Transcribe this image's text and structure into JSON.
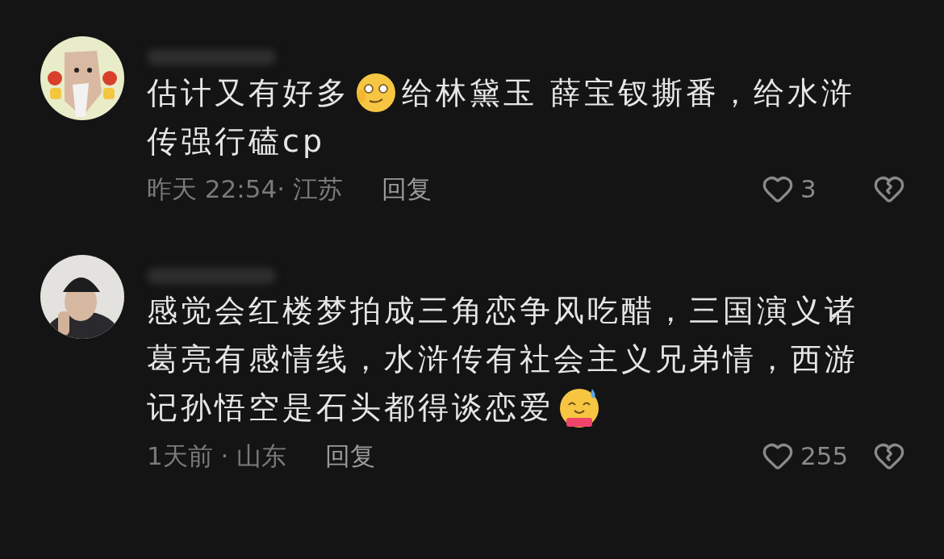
{
  "comments": [
    {
      "avatar": {
        "kind": "cartoon"
      },
      "lines": [
        [
          {
            "kind": "text",
            "text": "估计又有好多"
          },
          {
            "kind": "smirk_emoji"
          },
          {
            "kind": "text",
            "text": "给林黛玉 薛宝钗撕番，给水浒"
          }
        ],
        [
          {
            "kind": "text",
            "text": "传强行磕cp"
          }
        ]
      ],
      "time": "昨天 22:54· 江苏",
      "reply": "回复",
      "likes": "3"
    },
    {
      "avatar": {
        "kind": "person"
      },
      "lines": [
        [
          {
            "kind": "text",
            "text": "感觉会红楼梦拍成三角恋争风吃醋，三国演义诸"
          }
        ],
        [
          {
            "kind": "text",
            "text": "葛亮有感情线，水浒传有社会主义兄弟情，西游"
          }
        ],
        [
          {
            "kind": "text",
            "text": "记孙悟空是石头都得谈恋爱"
          },
          {
            "kind": "sweat_emoji"
          }
        ]
      ],
      "time": "1天前 · 山东",
      "reply": "回复",
      "likes": "255"
    }
  ]
}
